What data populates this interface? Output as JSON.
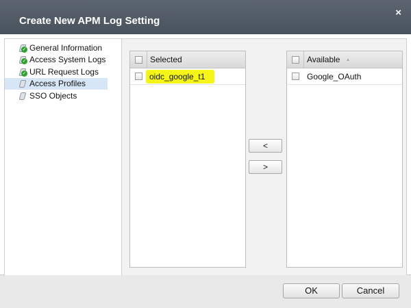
{
  "dialog": {
    "title": "Create New APM Log Setting",
    "close_icon": "×"
  },
  "nav": {
    "items": [
      {
        "label": "General Information",
        "complete": true
      },
      {
        "label": "Access System Logs",
        "complete": true
      },
      {
        "label": "URL Request Logs",
        "complete": true
      },
      {
        "label": "Access Profiles",
        "complete": false,
        "active": true
      },
      {
        "label": "SSO Objects",
        "complete": false
      }
    ]
  },
  "selected": {
    "header": "Selected",
    "items": [
      "oidc_google_t1"
    ],
    "highlight_color": "#f5f51a"
  },
  "available": {
    "header": "Available",
    "items": [
      "Google_OAuth"
    ],
    "sort_icon": "▲"
  },
  "move": {
    "left": "<",
    "right": ">"
  },
  "footer": {
    "ok": "OK",
    "cancel": "Cancel"
  }
}
